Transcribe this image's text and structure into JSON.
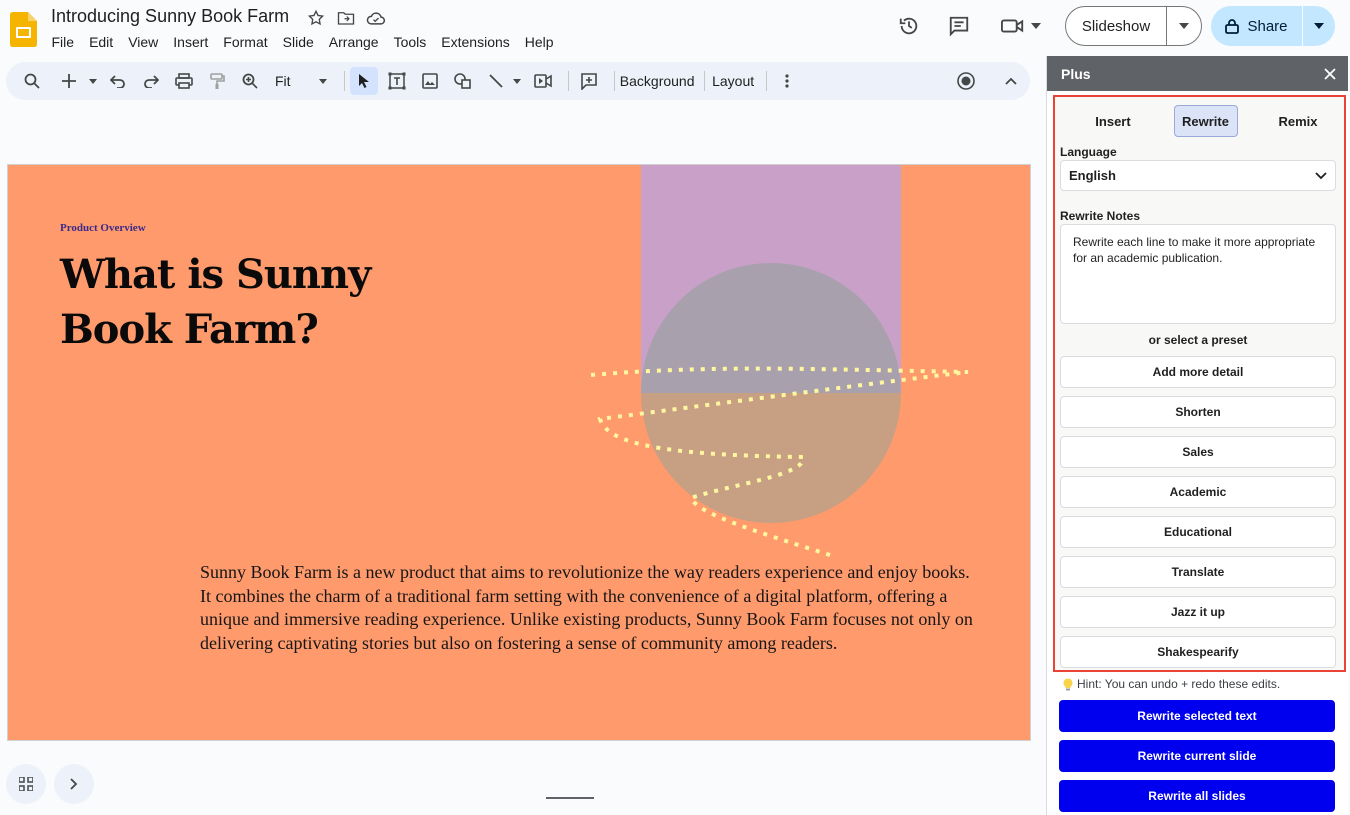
{
  "app": {
    "doc_title": "Introducing Sunny Book Farm",
    "brand_color": "#f4b400"
  },
  "menu": [
    "File",
    "Edit",
    "View",
    "Insert",
    "Format",
    "Slide",
    "Arrange",
    "Tools",
    "Extensions",
    "Help"
  ],
  "header": {
    "slideshow_label": "Slideshow",
    "share_label": "Share"
  },
  "toolbar": {
    "zoom_value": "Fit",
    "background_label": "Background",
    "layout_label": "Layout"
  },
  "slide": {
    "eyebrow": "Product Overview",
    "title_line1": "What is Sunny",
    "title_line2": "Book Farm?",
    "body": "Sunny Book Farm is a new product that aims to revolutionize the way readers experience and enjoy books. It combines the charm of a traditional farm setting with the convenience of a digital platform, offering a unique and immersive reading experience. Unlike existing products, Sunny Book Farm focuses not only on delivering captivating stories but also on fostering a sense of community among readers.",
    "background_color": "#ff9a6c"
  },
  "panel": {
    "title": "Plus",
    "tabs": [
      {
        "label": "Insert",
        "active": false
      },
      {
        "label": "Rewrite",
        "active": true
      },
      {
        "label": "Remix",
        "active": false
      }
    ],
    "language_label": "Language",
    "language_value": "English",
    "notes_label": "Rewrite Notes",
    "notes_value": "Rewrite each line to make it more appropriate for an academic publication.",
    "preset_label": "or select a preset",
    "presets": [
      "Add more detail",
      "Shorten",
      "Sales",
      "Academic",
      "Educational",
      "Translate",
      "Jazz it up",
      "Shakespearify"
    ],
    "hint": "Hint: You can undo + redo these edits.",
    "actions": [
      "Rewrite selected text",
      "Rewrite current slide",
      "Rewrite all slides"
    ],
    "highlight_color": "#ea4335",
    "action_color": "#0000ee"
  }
}
